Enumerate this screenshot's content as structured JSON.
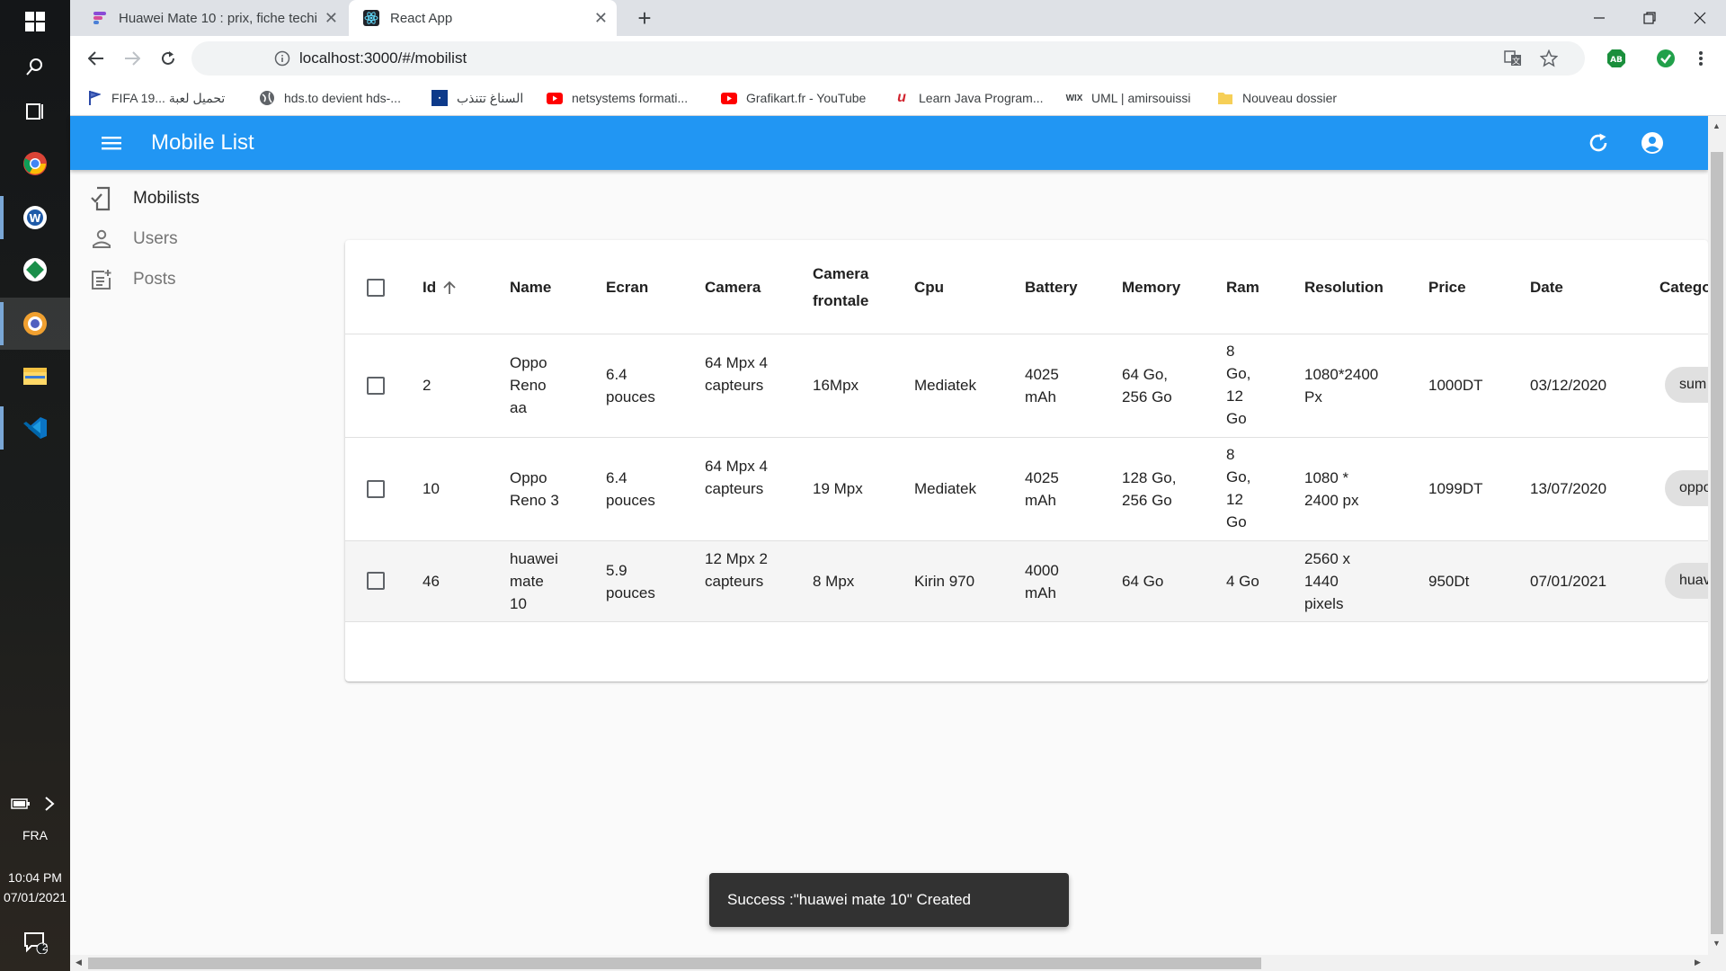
{
  "browser": {
    "tabs": [
      {
        "title": "Huawei Mate 10 : prix, fiche techi"
      },
      {
        "title": "React App"
      }
    ],
    "url": "localhost:3000/#/mobilist",
    "bookmarks": [
      {
        "label": "FIFA 19... تحميل لعبة",
        "icon": "flag-icon"
      },
      {
        "label": "hds.to devient hds-...",
        "icon": "globe-icon"
      },
      {
        "label": "السناغ تتنذب",
        "icon": "site-icon"
      },
      {
        "label": "netsystems formati...",
        "icon": "youtube-icon"
      },
      {
        "label": "Grafikart.fr - YouTube",
        "icon": "youtube-icon"
      },
      {
        "label": "Learn Java Program...",
        "icon": "udemy-icon"
      },
      {
        "label": "UML | amirsouissi",
        "icon": "wix-icon"
      },
      {
        "label": "Nouveau dossier",
        "icon": "folder-icon"
      }
    ]
  },
  "taskbar": {
    "lang": "FRA",
    "time": "10:04 PM",
    "date": "07/01/2021",
    "notifications": "2"
  },
  "app": {
    "title": "Mobile List",
    "accent": "#2196f3",
    "sidebar": [
      {
        "label": "Mobilists",
        "icon": "phone-check-icon",
        "active": true
      },
      {
        "label": "Users",
        "icon": "person-icon",
        "active": false
      },
      {
        "label": "Posts",
        "icon": "post-add-icon",
        "active": false
      }
    ],
    "table": {
      "headers": [
        "Id",
        "Name",
        "Ecran",
        "Camera",
        "Camera frontale",
        "Cpu",
        "Battery",
        "Memory",
        "Ram",
        "Resolution",
        "Price",
        "Date",
        "Catego"
      ],
      "rows": [
        {
          "id": "2",
          "name": "Oppo Reno aa",
          "ecran": "6.4 pouces",
          "camera": "64 Mpx 4 capteurs",
          "camera_frontale": "16Mpx",
          "cpu": "Mediatek",
          "battery": "4025 mAh",
          "memory": "64 Go, 256 Go",
          "ram": "8 Go, 12 Go",
          "resolution": "1080*2400 Px",
          "price": "1000DT",
          "date": "03/12/2020",
          "category": "sum"
        },
        {
          "id": "10",
          "name": "Oppo Reno 3",
          "ecran": "6.4 pouces",
          "camera": "64 Mpx 4 capteurs",
          "camera_frontale": "19 Mpx",
          "cpu": "Mediatek",
          "battery": "4025 mAh",
          "memory": "128 Go, 256 Go",
          "ram": "8 Go, 12 Go",
          "resolution": "1080 * 2400 px",
          "price": "1099DT",
          "date": "13/07/2020",
          "category": "oppo"
        },
        {
          "id": "46",
          "name": "huawei mate 10",
          "ecran": "5.9 pouces",
          "camera": "12 Mpx 2 capteurs",
          "camera_frontale": "8 Mpx",
          "cpu": "Kirin 970",
          "battery": "4000 mAh",
          "memory": "64 Go",
          "ram": "4 Go",
          "resolution": "2560 x 1440 pixels",
          "price": "950Dt",
          "date": "07/01/2021",
          "category": "huav"
        }
      ]
    },
    "snackbar": "Success :\"huawei mate 10\" Created"
  }
}
